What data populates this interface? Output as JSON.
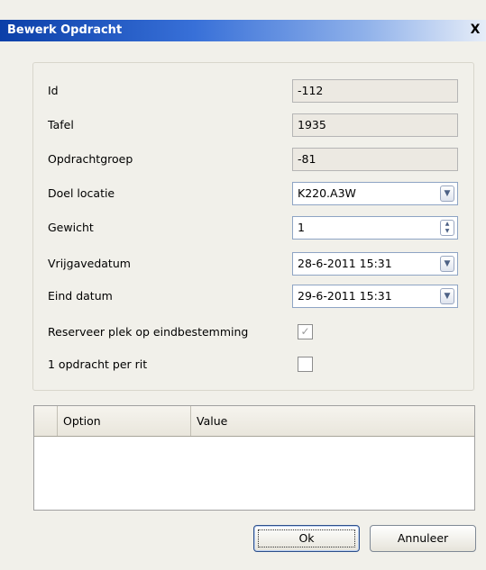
{
  "window": {
    "title": "Bewerk Opdracht",
    "close_glyph": "X"
  },
  "fields": {
    "id": {
      "label": "Id",
      "value": "-112"
    },
    "tafel": {
      "label": "Tafel",
      "value": "1935"
    },
    "opdrachtgroep": {
      "label": "Opdrachtgroep",
      "value": "-81"
    },
    "doel_locatie": {
      "label": "Doel locatie",
      "value": "K220.A3W"
    },
    "gewicht": {
      "label": "Gewicht",
      "value": "1"
    },
    "vrijgavedatum": {
      "label": "Vrijgavedatum",
      "value": "28-6-2011 15:31"
    },
    "eind_datum": {
      "label": "Eind datum",
      "value": "29-6-2011 15:31"
    }
  },
  "checkboxes": {
    "reserveer": {
      "label": "Reserveer plek op eindbestemming",
      "checked": true
    },
    "per_rit": {
      "label": "1 opdracht per rit",
      "checked": false
    }
  },
  "grid": {
    "columns": [
      "Option",
      "Value"
    ],
    "rows": []
  },
  "buttons": {
    "ok": "Ok",
    "cancel": "Annuleer"
  },
  "icons": {
    "combo": "chevron-down-icon",
    "spin": "spinner-icon",
    "check": "checkmark-icon",
    "close": "close-icon"
  }
}
